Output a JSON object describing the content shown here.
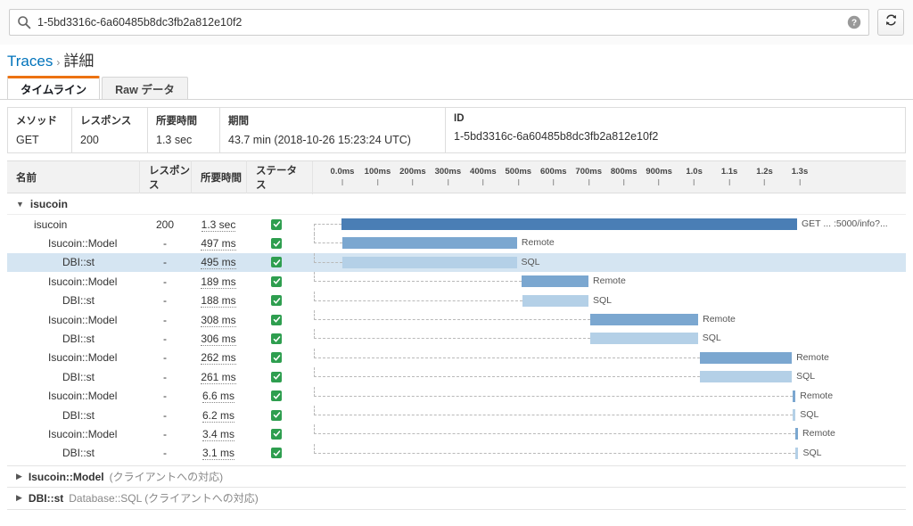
{
  "search": {
    "value": "1-5bd3316c-6a60485b8dc3fb2a812e10f2",
    "search_icon": "search-icon",
    "help_icon": "help-circle-icon",
    "refresh_icon": "refresh-icon"
  },
  "breadcrumb": {
    "root": "Traces",
    "separator": "›",
    "current": "詳細"
  },
  "tabs": [
    {
      "label": "タイムライン",
      "active": true
    },
    {
      "label": "Raw データ",
      "active": false
    }
  ],
  "summary": {
    "method": {
      "label": "メソッド",
      "value": "GET"
    },
    "response": {
      "label": "レスポンス",
      "value": "200"
    },
    "duration": {
      "label": "所要時間",
      "value": "1.3 sec"
    },
    "period": {
      "label": "期間",
      "value": "43.7 min (2018-10-26 15:23:24 UTC)"
    },
    "id": {
      "label": "ID",
      "value": "1-5bd3316c-6a60485b8dc3fb2a812e10f2"
    }
  },
  "table": {
    "headers": {
      "name": "名前",
      "response": "レスポンス",
      "duration": "所要時間",
      "status": "ステータス"
    },
    "group_label": "isucoin",
    "rows": [
      {
        "name": "isucoin",
        "indent": 1,
        "response": "200",
        "duration": "1.3 sec",
        "status": "ok",
        "selected": false,
        "bar": {
          "start": 0,
          "end": 1.295,
          "color": "dark",
          "label": "GET ... :5000/info?..."
        }
      },
      {
        "name": "Isucoin::Model",
        "indent": 2,
        "response": "-",
        "duration": "497 ms",
        "status": "ok",
        "selected": false,
        "bar": {
          "start": 0.002,
          "end": 0.499,
          "color": "mid",
          "label": "Remote"
        }
      },
      {
        "name": "DBI::st",
        "indent": 3,
        "response": "-",
        "duration": "495 ms",
        "status": "ok",
        "selected": true,
        "bar": {
          "start": 0.003,
          "end": 0.498,
          "color": "light",
          "label": "SQL"
        }
      },
      {
        "name": "Isucoin::Model",
        "indent": 2,
        "response": "-",
        "duration": "189 ms",
        "status": "ok",
        "selected": false,
        "bar": {
          "start": 0.513,
          "end": 0.702,
          "color": "mid",
          "label": "Remote"
        }
      },
      {
        "name": "DBI::st",
        "indent": 3,
        "response": "-",
        "duration": "188 ms",
        "status": "ok",
        "selected": false,
        "bar": {
          "start": 0.514,
          "end": 0.702,
          "color": "light",
          "label": "SQL"
        }
      },
      {
        "name": "Isucoin::Model",
        "indent": 2,
        "response": "-",
        "duration": "308 ms",
        "status": "ok",
        "selected": false,
        "bar": {
          "start": 0.706,
          "end": 1.014,
          "color": "mid",
          "label": "Remote"
        }
      },
      {
        "name": "DBI::st",
        "indent": 3,
        "response": "-",
        "duration": "306 ms",
        "status": "ok",
        "selected": false,
        "bar": {
          "start": 0.707,
          "end": 1.013,
          "color": "light",
          "label": "SQL"
        }
      },
      {
        "name": "Isucoin::Model",
        "indent": 2,
        "response": "-",
        "duration": "262 ms",
        "status": "ok",
        "selected": false,
        "bar": {
          "start": 1.018,
          "end": 1.28,
          "color": "mid",
          "label": "Remote"
        }
      },
      {
        "name": "DBI::st",
        "indent": 3,
        "response": "-",
        "duration": "261 ms",
        "status": "ok",
        "selected": false,
        "bar": {
          "start": 1.019,
          "end": 1.28,
          "color": "light",
          "label": "SQL"
        }
      },
      {
        "name": "Isucoin::Model",
        "indent": 2,
        "response": "-",
        "duration": "6.6 ms",
        "status": "ok",
        "selected": false,
        "bar": {
          "start": 1.283,
          "end": 1.29,
          "color": "mid",
          "label": "Remote"
        }
      },
      {
        "name": "DBI::st",
        "indent": 3,
        "response": "-",
        "duration": "6.2 ms",
        "status": "ok",
        "selected": false,
        "bar": {
          "start": 1.283,
          "end": 1.289,
          "color": "light",
          "label": "SQL"
        }
      },
      {
        "name": "Isucoin::Model",
        "indent": 2,
        "response": "-",
        "duration": "3.4 ms",
        "status": "ok",
        "selected": false,
        "bar": {
          "start": 1.29,
          "end": 1.294,
          "color": "mid",
          "label": "Remote"
        }
      },
      {
        "name": "DBI::st",
        "indent": 3,
        "response": "-",
        "duration": "3.1 ms",
        "status": "ok",
        "selected": false,
        "bar": {
          "start": 1.291,
          "end": 1.294,
          "color": "light",
          "label": "SQL"
        }
      }
    ],
    "axis": {
      "ticks": [
        "0.0ms",
        "100ms",
        "200ms",
        "300ms",
        "400ms",
        "500ms",
        "600ms",
        "700ms",
        "800ms",
        "900ms",
        "1.0s",
        "1.1s",
        "1.2s",
        "1.3s"
      ],
      "min": 0,
      "max": 1.3
    }
  },
  "footer_groups": [
    {
      "name": "Isucoin::Model",
      "sub": "(クライアントへの対応)"
    },
    {
      "name": "DBI::st",
      "sub": "Database::SQL (クライアントへの対応)"
    }
  ],
  "colors": {
    "bar_dark": "#4a7eb5",
    "bar_mid": "#7ba7d0",
    "bar_light": "#b4d0e7",
    "accent": "#ec7211",
    "link": "#0073bb",
    "status_ok": "#2e9e4f",
    "row_selected": "#d5e5f2"
  }
}
